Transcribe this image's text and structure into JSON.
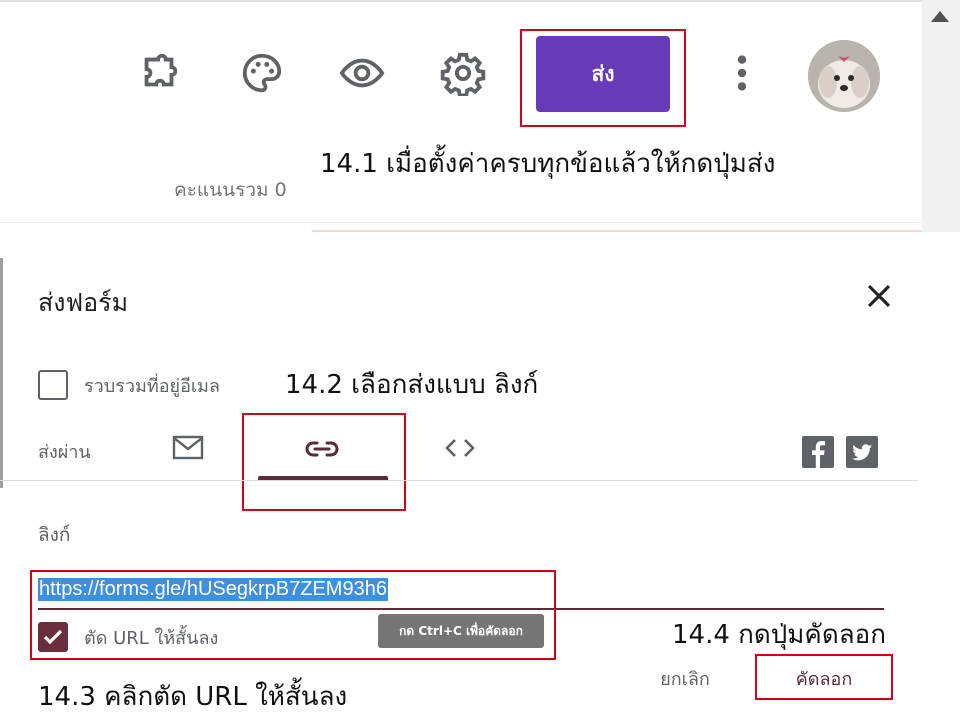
{
  "toolbar": {
    "send_label": "ส่ง",
    "icons": [
      "puzzle-icon",
      "palette-icon",
      "eye-icon",
      "gear-icon",
      "more-vert-icon"
    ]
  },
  "top": {
    "total_score": "คะแนนรวม 0",
    "annotation": "14.1 เมื่อตั้งค่าครบทุกข้อแล้วให้กดปุ่มส่ง"
  },
  "dialog": {
    "title": "ส่งฟอร์ม",
    "collect_email": "รวบรวมที่อยู่อีเมล",
    "collect_email_checked": false,
    "send_via": "ส่งผ่าน",
    "active_tab": "link",
    "link_label": "ลิงก์",
    "link_value": "https://forms.gle/hUSegkrpB7ZEM93h6",
    "shorten_label": "ตัด URL ให้สั้นลง",
    "shorten_checked": true,
    "copy_hint": "กด Ctrl+C เพื่อคัดลอก",
    "cancel_label": "ยกเลิก",
    "copy_label": "คัดลอก"
  },
  "annotations": {
    "step_142": "14.2 เลือกส่งแบบ ลิงก์",
    "step_143": "14.3 คลิกตัด URL ให้สั้นลง",
    "step_144": "14.4 กดปุ่มคัดลอก"
  },
  "colors": {
    "accent_purple": "#673ab7",
    "theme_maroon": "#5c2b3a",
    "annotation_red": "#d0021b",
    "selection_blue": "#3d8fe0"
  }
}
